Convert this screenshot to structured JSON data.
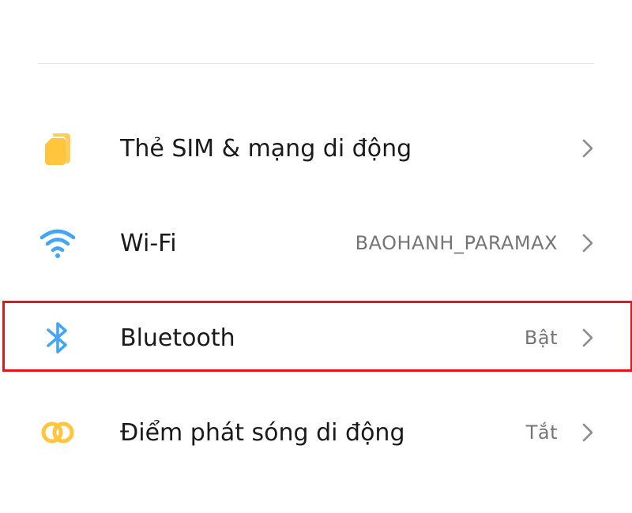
{
  "settings": {
    "items": [
      {
        "label": "Thẻ SIM & mạng di động",
        "value": "",
        "icon": "sim-card-icon",
        "icon_color": "#FFC53D"
      },
      {
        "label": "Wi-Fi",
        "value": "BAOHANH_PARAMAX",
        "icon": "wifi-icon",
        "icon_color": "#42A5F5"
      },
      {
        "label": "Bluetooth",
        "value": "Bật",
        "icon": "bluetooth-icon",
        "icon_color": "#42A5F5"
      },
      {
        "label": "Điểm phát sóng di động",
        "value": "Tắt",
        "icon": "hotspot-icon",
        "icon_color": "#FFC53D"
      }
    ]
  },
  "highlight_color": "#E8141C"
}
